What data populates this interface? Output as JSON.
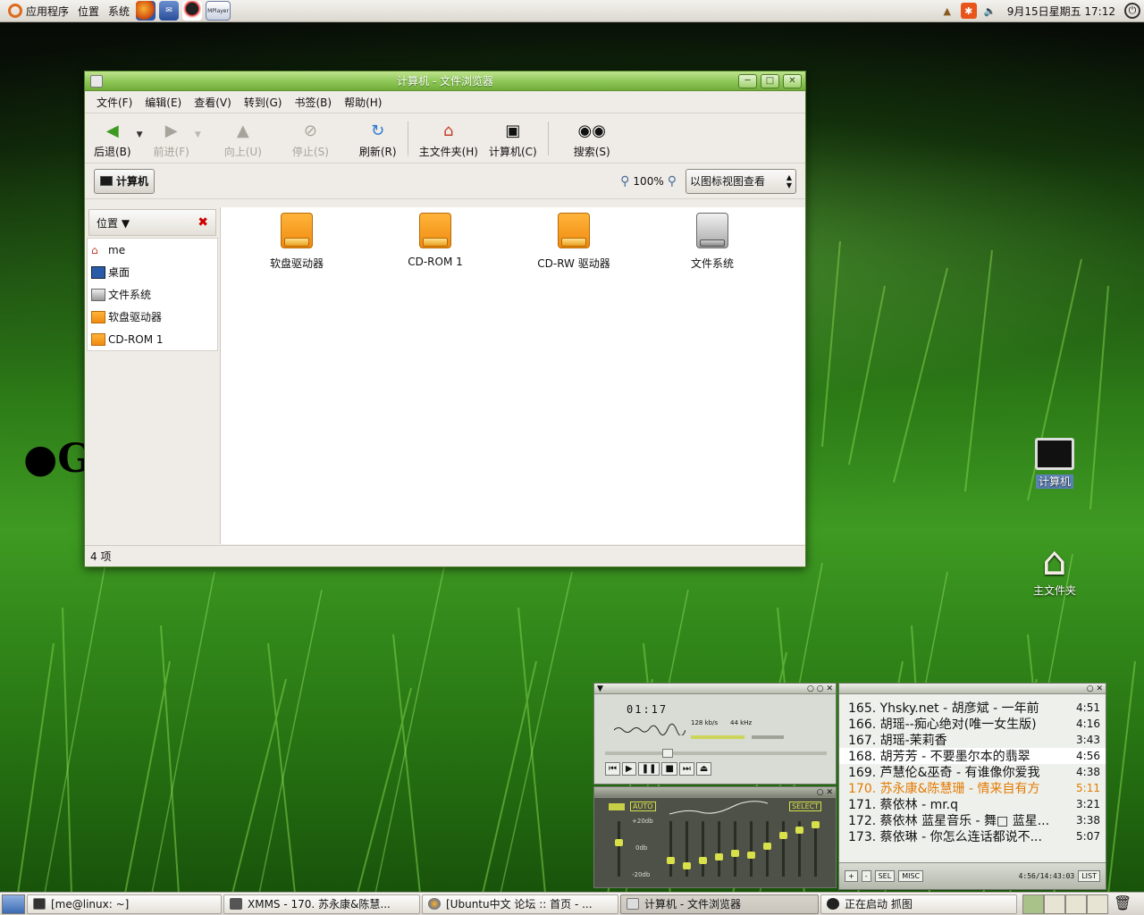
{
  "top_panel": {
    "menus": [
      "应用程序",
      "位置",
      "系统"
    ],
    "launchers": [
      "firefox-icon",
      "thunderbird-icon",
      "qq-icon",
      "mplayer-icon"
    ],
    "mplayer_label": "MPlayer",
    "clock": "9月15日星期五 17:12"
  },
  "window": {
    "title": "计算机 - 文件浏览器",
    "menu": [
      "文件(F)",
      "编辑(E)",
      "查看(V)",
      "转到(G)",
      "书签(B)",
      "帮助(H)"
    ],
    "toolbar": {
      "back": "后退(B)",
      "forward": "前进(F)",
      "up": "向上(U)",
      "stop": "停止(S)",
      "reload": "刷新(R)",
      "home": "主文件夹(H)",
      "computer": "计算机(C)",
      "search": "搜索(S)"
    },
    "location_button": "计算机",
    "zoom": "100%",
    "view_mode": "以图标视图查看",
    "sidebar": {
      "header": "位置",
      "items": [
        "me",
        "桌面",
        "文件系统",
        "软盘驱动器",
        "CD-ROM 1"
      ]
    },
    "files": [
      "软盘驱动器",
      "CD-ROM 1",
      "CD-RW 驱动器",
      "文件系统"
    ],
    "status": "4 项"
  },
  "desktop": {
    "icons": [
      "计算机",
      "主文件夹"
    ]
  },
  "xmms": {
    "time": "01:17",
    "bitrate": "128 kb/s",
    "samplerate": "44 kHz",
    "eq_auto": "AUTO",
    "eq_select": "SELECT",
    "eq_top": "+20db",
    "eq_mid": "0db",
    "eq_bot": "-20db",
    "playlist": [
      {
        "title": "165. Yhsky.net - 胡彦斌 - 一年前",
        "duration": "4:51"
      },
      {
        "title": "166. 胡瑶--痴心绝对(唯一女生版)",
        "duration": "4:16"
      },
      {
        "title": "167. 胡瑶-茉莉香",
        "duration": "3:43"
      },
      {
        "title": "168. 胡芳芳 - 不要墨尔本的翡翠",
        "duration": "4:56"
      },
      {
        "title": "169. 芦慧伦&巫奇 - 有谁像你爱我",
        "duration": "4:38"
      },
      {
        "title": "170. 苏永康&陈慧珊 - 情来自有方",
        "duration": "5:11"
      },
      {
        "title": "171. 蔡依林 - mr.q",
        "duration": "3:21"
      },
      {
        "title": "172. 蔡依林 蓝星音乐 - 舞□ 蓝星...",
        "duration": "3:38"
      },
      {
        "title": "173. 蔡依琳 - 你怎么连话都说不...",
        "duration": "5:07"
      }
    ],
    "pl_total": "4:56/14:43:03",
    "pl_buttons": [
      "+",
      "-",
      "SEL",
      "MISC",
      "LIST"
    ]
  },
  "bottom_panel": {
    "tasks": [
      "[me@linux: ~]",
      "XMMS - 170. 苏永康&陈慧...",
      "[Ubuntu中文 论坛 :: 首页 - ...",
      "计算机 - 文件浏览器",
      "正在启动 抓图"
    ]
  },
  "colors": {
    "title_green": "#8cc655",
    "drive_orange": "#f08a10",
    "playing_orange": "#e37a00"
  }
}
